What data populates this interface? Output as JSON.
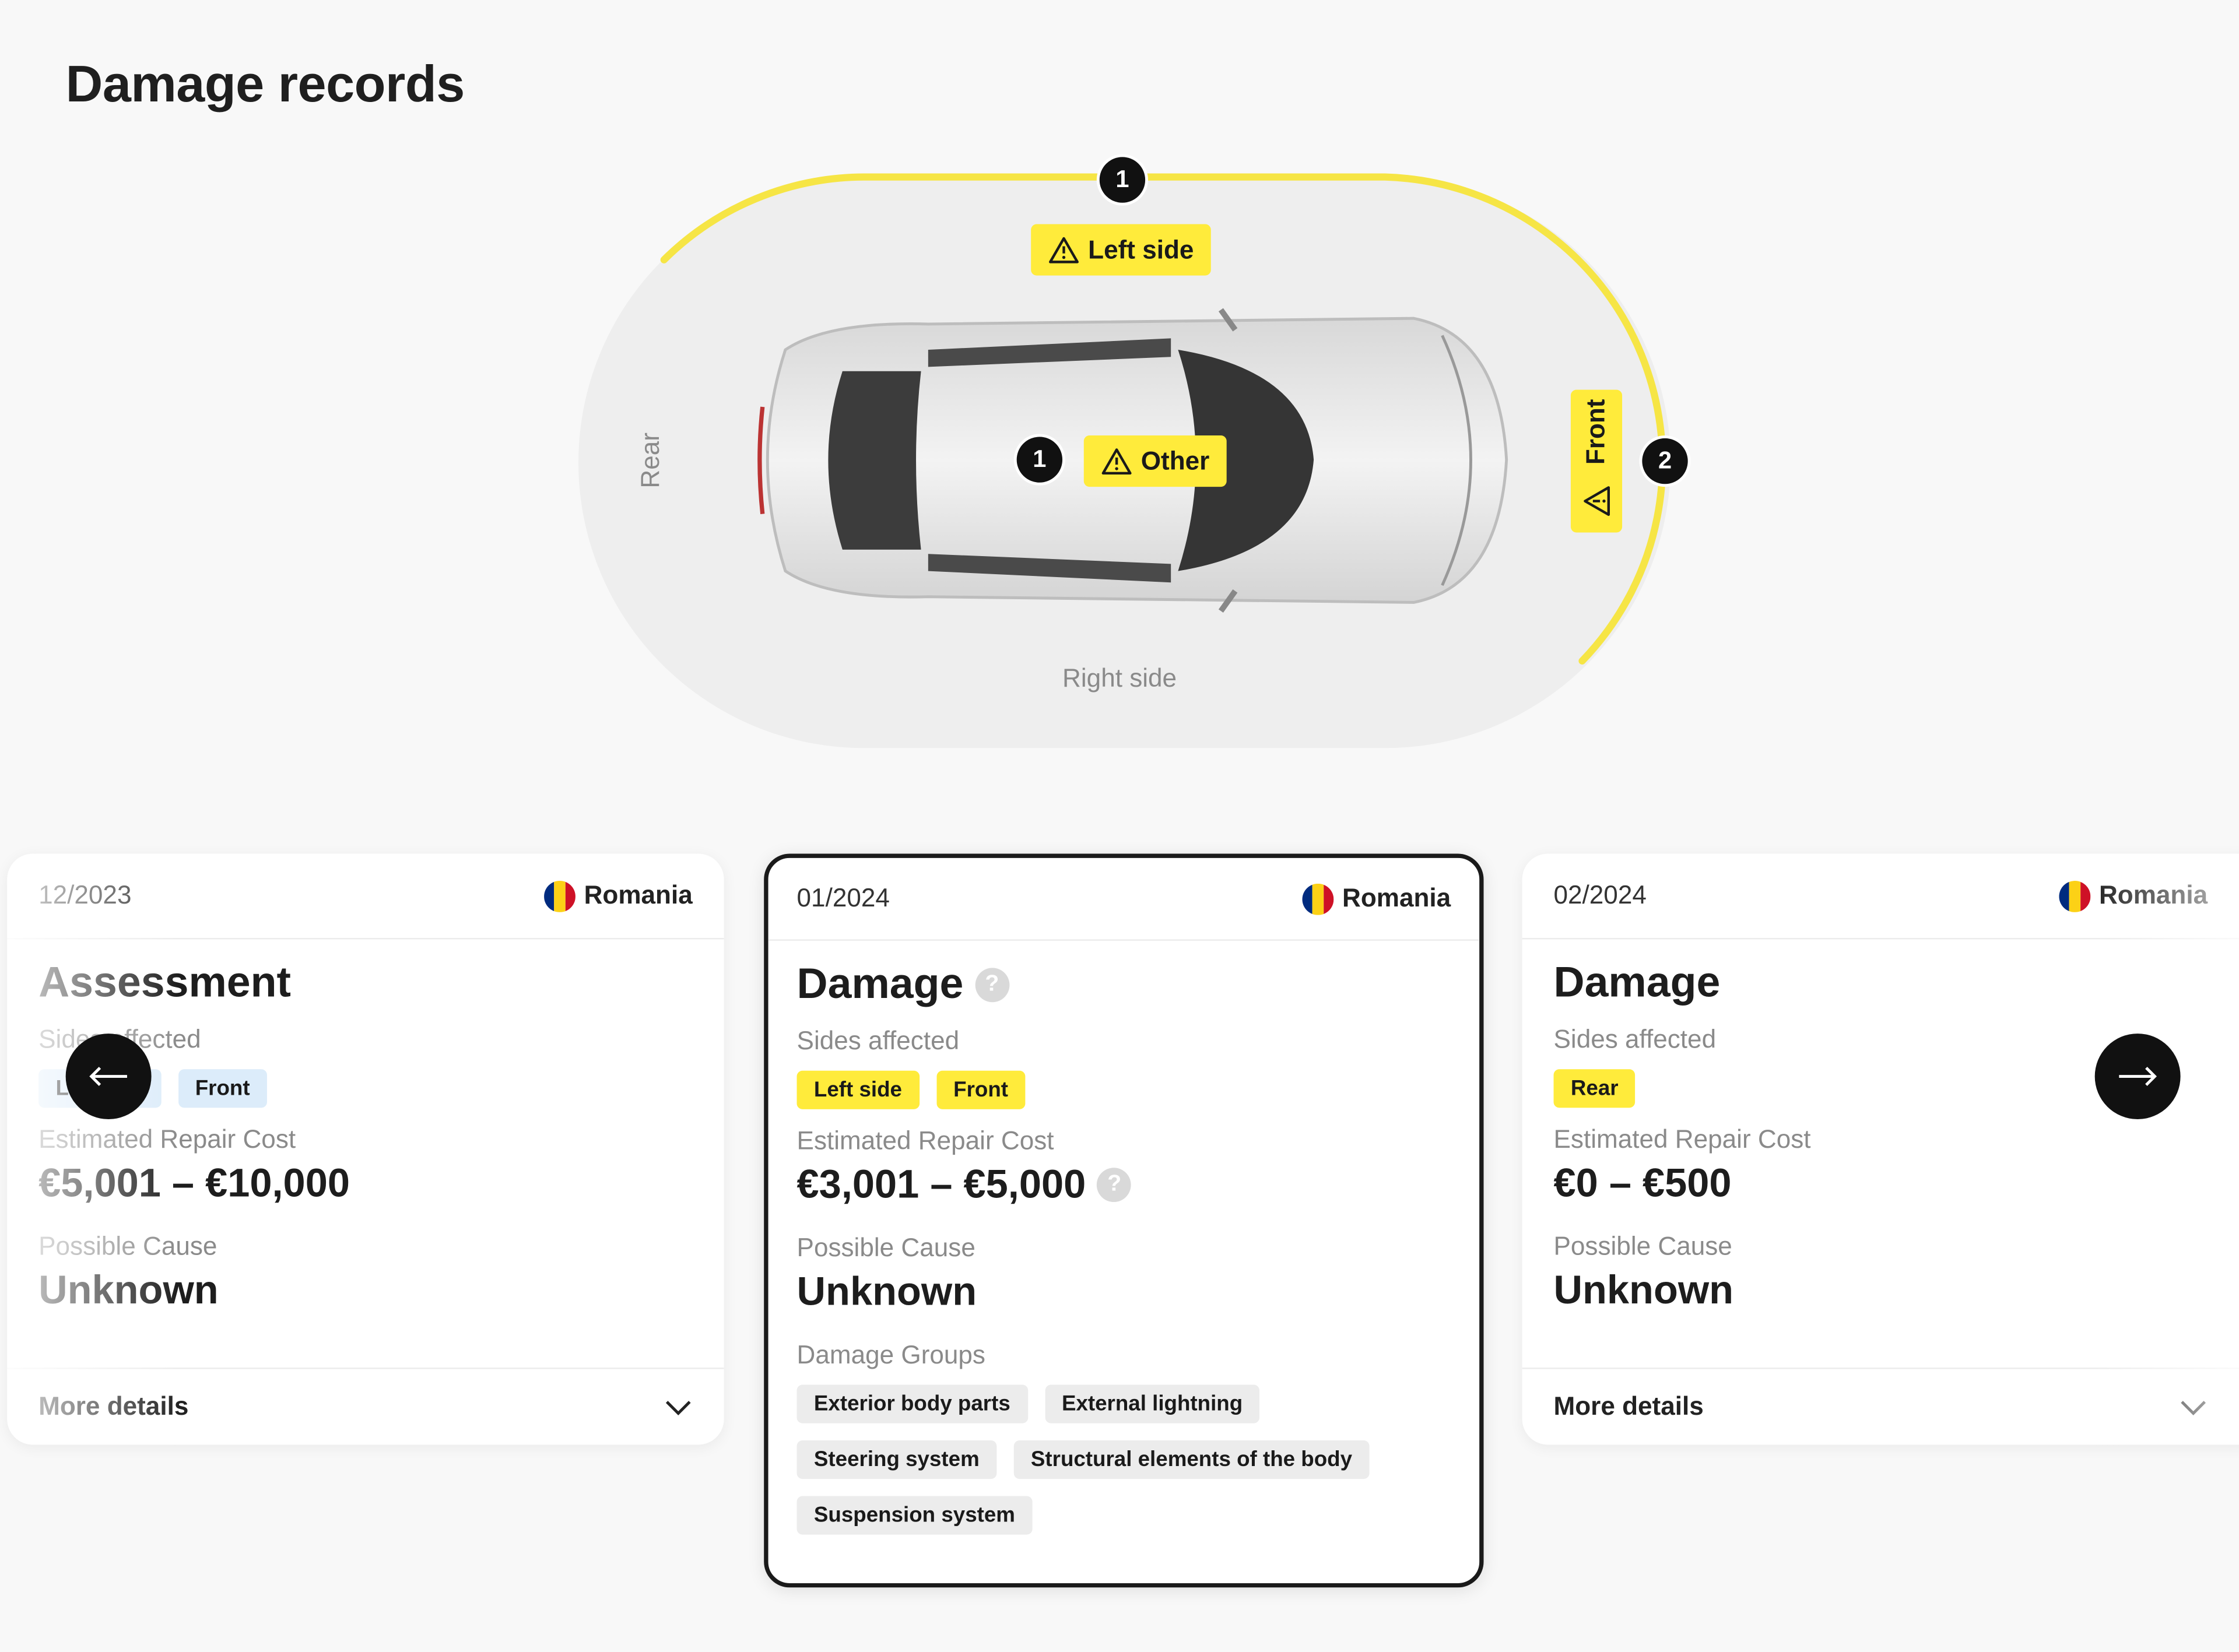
{
  "page": {
    "title": "Damage records"
  },
  "diagram": {
    "sides": {
      "rear": "Rear",
      "right": "Right side"
    },
    "zones": [
      {
        "label": "Left side",
        "count": "1"
      },
      {
        "label": "Other",
        "count": "1"
      },
      {
        "label": "Front",
        "count": "2"
      }
    ],
    "colors": {
      "highlight": "#ffeb3b",
      "ring": "#f6e545",
      "dot": "#111111"
    }
  },
  "records": [
    {
      "date": "12/2023",
      "country": "Romania",
      "title": "Assessment",
      "sides_label": "Sides affected",
      "sides": [
        "Left side",
        "Front"
      ],
      "cost_label": "Estimated Repair Cost",
      "cost": "€5,001 – €10,000",
      "cause_label": "Possible Cause",
      "cause": "Unknown",
      "more": "More details"
    },
    {
      "date": "01/2024",
      "country": "Romania",
      "title": "Damage",
      "sides_label": "Sides affected",
      "sides": [
        "Left side",
        "Front"
      ],
      "cost_label": "Estimated Repair Cost",
      "cost": "€3,001 – €5,000",
      "cause_label": "Possible Cause",
      "cause": "Unknown",
      "groups_label": "Damage Groups",
      "groups": [
        "Exterior body parts",
        "External lightning",
        "Steering system",
        "Structural elements of the body",
        "Suspension system"
      ],
      "selected": true
    },
    {
      "date": "02/2024",
      "country": "Romania",
      "title": "Damage",
      "sides_label": "Sides affected",
      "sides": [
        "Rear"
      ],
      "cost_label": "Estimated Repair Cost",
      "cost": "€0 – €500",
      "cause_label": "Possible Cause",
      "cause": "Unknown",
      "more": "More details"
    }
  ],
  "icons": {
    "warning": "warning-triangle-icon",
    "help": "question-mark-icon",
    "prev": "arrow-left-icon",
    "next": "arrow-right-icon",
    "expand": "chevron-down-icon",
    "help_glyph": "?"
  }
}
